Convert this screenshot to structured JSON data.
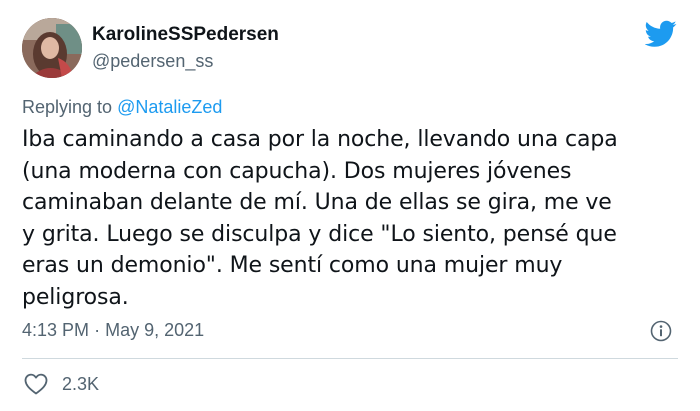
{
  "author": {
    "display_name": "KarolineSSPedersen",
    "handle": "@pedersen_ss"
  },
  "reply": {
    "prefix": "Replying to",
    "mention": "@NatalieZed"
  },
  "tweet": {
    "lines": [
      "Iba caminando a casa por la noche, llevando una capa",
      "(una moderna con capucha). Dos mujeres jóvenes",
      "caminaban delante de mí. Una de ellas se gira, me ve",
      "y grita. Luego se disculpa y dice \"Lo siento, pensé que",
      "eras un demonio\". Me sentí como una mujer muy",
      "peligrosa."
    ]
  },
  "meta": {
    "time": "4:13 PM",
    "separator": "·",
    "date": "May 9, 2021"
  },
  "actions": {
    "like_count": "2.3K"
  },
  "icons": {
    "brand": "twitter-bird-icon",
    "info": "info-icon",
    "like": "heart-icon"
  },
  "colors": {
    "accent": "#1d9bf0",
    "secondary_text": "#536471",
    "primary_text": "#0f1419",
    "divider": "#cfd9de"
  }
}
